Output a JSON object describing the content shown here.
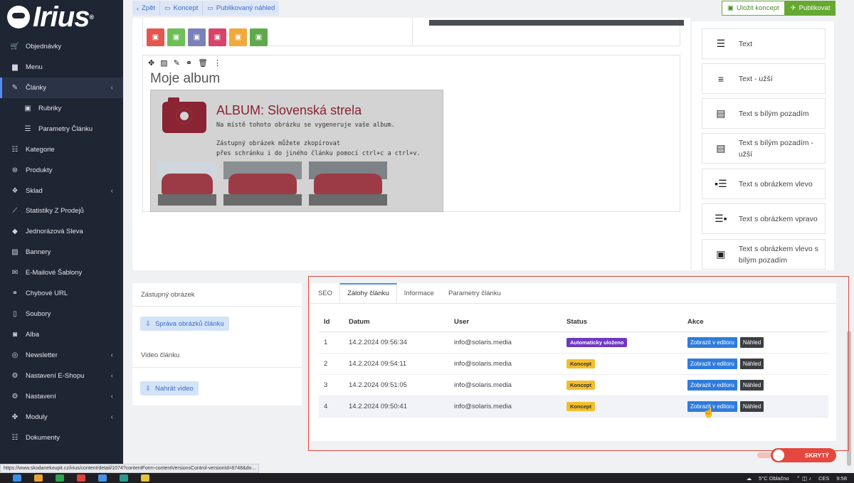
{
  "logo": {
    "text": "Irius",
    "mark": "®"
  },
  "sidebar": {
    "items": [
      {
        "label": "Objednávky",
        "icon": "cart-icon",
        "glyph": "🛒"
      },
      {
        "label": "Menu",
        "icon": "folder-icon",
        "glyph": "▆"
      },
      {
        "label": "Články",
        "icon": "pencil-icon",
        "glyph": "✎",
        "chevron": "‹"
      },
      {
        "label": "Rubriky",
        "icon": "box-icon",
        "glyph": "▣"
      },
      {
        "label": "Parametry Článku",
        "icon": "sliders-icon",
        "glyph": "☰"
      },
      {
        "label": "Kategorie",
        "icon": "list-icon",
        "glyph": "☷"
      },
      {
        "label": "Produkty",
        "icon": "dribbble-icon",
        "glyph": "⊛"
      },
      {
        "label": "Sklad",
        "icon": "dropbox-icon",
        "glyph": "❖",
        "chevron": "‹"
      },
      {
        "label": "Statistiky Z Prodejů",
        "icon": "chart-line-icon",
        "glyph": "⟋"
      },
      {
        "label": "Jednorázová Sleva",
        "icon": "tag-icon",
        "glyph": "◆"
      },
      {
        "label": "Bannery",
        "icon": "image-icon",
        "glyph": "▨"
      },
      {
        "label": "E-Mailové Šablony",
        "icon": "envelope-icon",
        "glyph": "✉"
      },
      {
        "label": "Chybové URL",
        "icon": "link-icon",
        "glyph": "⚭"
      },
      {
        "label": "Soubory",
        "icon": "file-icon",
        "glyph": "▯"
      },
      {
        "label": "Alba",
        "icon": "camera-icon",
        "glyph": "◙"
      },
      {
        "label": "Newsletter",
        "icon": "newsletter-icon",
        "glyph": "◎",
        "chevron": "‹"
      },
      {
        "label": "Nastavení E-Shopu",
        "icon": "cogs-icon",
        "glyph": "⚙",
        "chevron": "‹"
      },
      {
        "label": "Nastavení",
        "icon": "cog-icon",
        "glyph": "⚙",
        "chevron": "‹"
      },
      {
        "label": "Moduly",
        "icon": "puzzle-icon",
        "glyph": "✤",
        "chevron": "‹"
      },
      {
        "label": "Dokumenty",
        "icon": "documents-icon",
        "glyph": "☷"
      }
    ]
  },
  "toolbar": {
    "back_label": "Zpět",
    "back_glyph": "‹",
    "draft_label": "Koncept",
    "draft_glyph": "▭",
    "published_preview_label": "Publikovaný náhled",
    "published_preview_glyph": "▭",
    "save_draft_label": "Uložit koncept",
    "save_draft_glyph": "▣",
    "publish_label": "Publikovat",
    "publish_glyph": "✈"
  },
  "editor": {
    "block_icon_colors": [
      "#e5564f",
      "#6fbf57",
      "#7b80b8",
      "#d9436a",
      "#f2a93b",
      "#5ea94b"
    ],
    "block_tools": [
      "✥",
      "▨",
      "✎",
      "⚭",
      "🗑",
      "⋮"
    ],
    "block_title": "Moje album",
    "album": {
      "title": "ALBUM: Slovenská strela",
      "line1": "Na místě tohoto obrázku se vygeneruje vaše album.",
      "line2": "Zástupný obrázek můžete zkopírovat",
      "line3": "přes schránku i do jiného článku pomocí ctrl+c a ctrl+v."
    }
  },
  "palette": {
    "items": [
      {
        "label": "Text",
        "icon": "align-left-icon",
        "glyph": "☰"
      },
      {
        "label": "Text - užší",
        "icon": "align-narrow-icon",
        "glyph": "≡"
      },
      {
        "label": "Text s bílým pozadím",
        "icon": "text-box-icon",
        "glyph": "▤"
      },
      {
        "label": "Text s bílým pozadím - užší",
        "icon": "text-box-narrow-icon",
        "glyph": "▤"
      },
      {
        "label": "Text s obrázkem vlevo",
        "icon": "image-left-icon",
        "glyph": "▪☰"
      },
      {
        "label": "Text s obrázkem vpravo",
        "icon": "image-right-icon",
        "glyph": "☰▪"
      },
      {
        "label": "Text s obrázkem vlevo s bílým pozadím",
        "icon": "image-left-box-icon",
        "glyph": "▣"
      }
    ]
  },
  "left_panel": {
    "placeholder_image_label": "Zástupný obrázek",
    "manage_images_label": "Správa obrázků článku",
    "video_label": "Video článku",
    "upload_video_label": "Nahrát video",
    "upload_glyph": "⇩"
  },
  "tabs": [
    {
      "label": "SEO",
      "active": false
    },
    {
      "label": "Zálohy článku",
      "active": true
    },
    {
      "label": "Informace",
      "active": false
    },
    {
      "label": "Parametry článku",
      "active": false
    }
  ],
  "table": {
    "headers": {
      "id": "Id",
      "date": "Datum",
      "user": "User",
      "status": "Status",
      "actions": "Akce"
    },
    "rows": [
      {
        "id": "1",
        "date": "14.2.2024 09:56:34",
        "user": "info@solaris.media",
        "status": "Automaticky uloženo",
        "status_type": "auto"
      },
      {
        "id": "2",
        "date": "14.2.2024 09:54:11",
        "user": "info@solaris.media",
        "status": "Koncept",
        "status_type": "koncept"
      },
      {
        "id": "3",
        "date": "14.2.2024 09:51:05",
        "user": "info@solaris.media",
        "status": "Koncept",
        "status_type": "koncept"
      },
      {
        "id": "4",
        "date": "14.2.2024 09:50:41",
        "user": "info@solaris.media",
        "status": "Koncept",
        "status_type": "koncept"
      }
    ],
    "edit_label": "Zobrazit v editoru",
    "preview_label": "Náhled"
  },
  "toggle": {
    "label": "SKRYTÝ"
  },
  "status_url": "https://www.skodanekoupit.cz/irius/content/detail/1074?contentForm-contentVersionsControl-versionId=8748&do...",
  "taskbar": {
    "weather": "5°C Oblačno",
    "lang": "CES",
    "time": "9:58",
    "tray": "⌃ ◫ ♪",
    "weather_glyph": "☁",
    "icon_colors": [
      "#3a8ee6",
      "#e8a23a",
      "#2fa34f",
      "#db4437",
      "#4a90e2",
      "#2b9a8d",
      "#e6c23a"
    ]
  },
  "colors": {
    "accent": "#4f8ef7",
    "danger": "#e5483e",
    "success": "#65a832",
    "sidebar_bg": "#1e2533"
  }
}
